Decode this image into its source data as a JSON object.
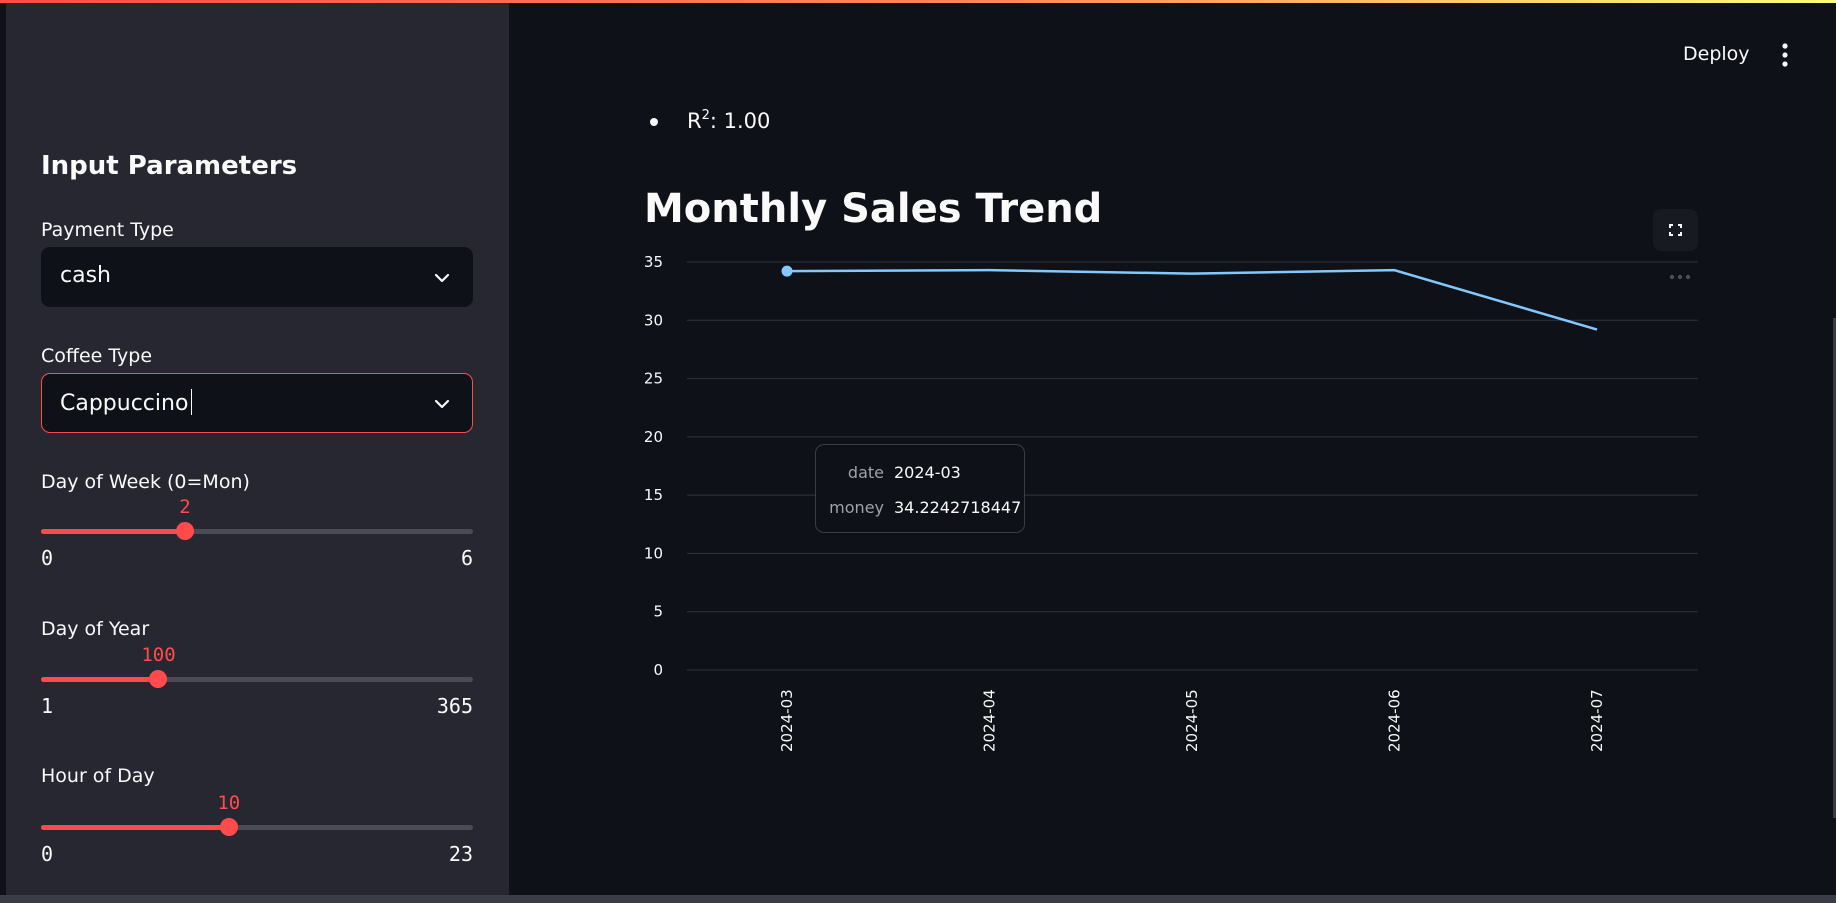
{
  "header": {
    "deploy_label": "Deploy",
    "menu_icon": "more-vertical-icon"
  },
  "sidebar": {
    "title": "Input Parameters",
    "payment": {
      "label": "Payment Type",
      "value": "cash"
    },
    "coffee": {
      "label": "Coffee Type",
      "value": "Cappuccino"
    },
    "sliders": [
      {
        "label": "Day of Week (0=Mon)",
        "value": 2,
        "value_text": "2",
        "min": 0,
        "max": 6,
        "min_text": "0",
        "max_text": "6"
      },
      {
        "label": "Day of Year",
        "value": 100,
        "value_text": "100",
        "min": 1,
        "max": 365,
        "min_text": "1",
        "max_text": "365"
      },
      {
        "label": "Hour of Day",
        "value": 10,
        "value_text": "10",
        "min": 0,
        "max": 23,
        "min_text": "0",
        "max_text": "23"
      }
    ]
  },
  "main": {
    "metric_prefix": "R",
    "metric_sup": "2",
    "metric_rest": ": 1.00",
    "chart_title": "Monthly Sales Trend",
    "tooltip": {
      "date_label": "date",
      "date_value": "2024-03",
      "money_label": "money",
      "money_value": "34.2242718447"
    }
  },
  "colors": {
    "accent": "#ff4b4b",
    "line": "#83c9ff",
    "grid": "#31333f",
    "background": "#0e1117",
    "sidebar": "#262730"
  },
  "chart_data": {
    "type": "line",
    "title": "Monthly Sales Trend",
    "x": [
      "2024-03",
      "2024-04",
      "2024-05",
      "2024-06",
      "2024-07"
    ],
    "series": [
      {
        "values": [
          34.22,
          34.3,
          34.0,
          34.3,
          29.2
        ]
      }
    ],
    "ylim": [
      0,
      35
    ],
    "yticks": [
      0,
      5,
      10,
      15,
      20,
      25,
      30,
      35
    ],
    "xlabel": "",
    "ylabel": "",
    "grid": true,
    "highlighted_index": 0
  }
}
